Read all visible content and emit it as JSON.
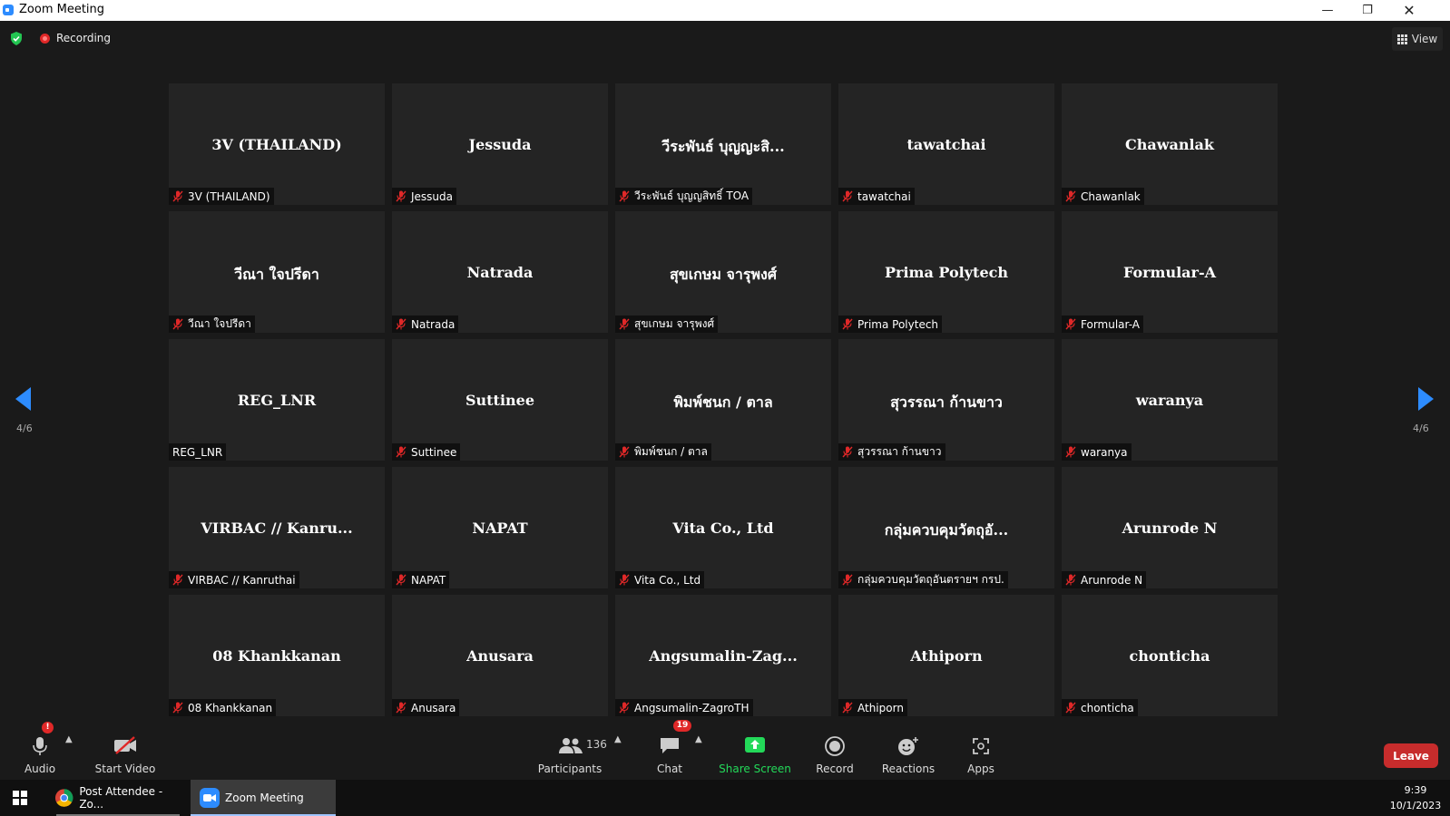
{
  "window": {
    "title": "Zoom Meeting"
  },
  "topbar": {
    "recording_label": "Recording",
    "view_label": "View"
  },
  "pagination": {
    "left": "4/6",
    "right": "4/6"
  },
  "participants": [
    {
      "display": "3V (THAILAND)",
      "name": "3V (THAILAND)",
      "muted": true
    },
    {
      "display": "Jessuda",
      "name": "Jessuda",
      "muted": true
    },
    {
      "display": "วีระพันธ์ บุญญะสิ...",
      "name": "วีระพันธ์ บุญญสิทธิ์ TOA",
      "muted": true
    },
    {
      "display": "tawatchai",
      "name": "tawatchai",
      "muted": true
    },
    {
      "display": "Chawanlak",
      "name": "Chawanlak",
      "muted": true
    },
    {
      "display": "วีณา ใจปรีดา",
      "name": "วีณา ใจปรีดา",
      "muted": true
    },
    {
      "display": "Natrada",
      "name": "Natrada",
      "muted": true
    },
    {
      "display": "สุขเกษม จารุพงศ์",
      "name": "สุขเกษม จารุพงศ์",
      "muted": true
    },
    {
      "display": "Prima Polytech",
      "name": "Prima Polytech",
      "muted": true
    },
    {
      "display": "Formular-A",
      "name": "Formular-A",
      "muted": true
    },
    {
      "display": "REG_LNR",
      "name": "REG_LNR",
      "muted": false
    },
    {
      "display": "Suttinee",
      "name": "Suttinee",
      "muted": true
    },
    {
      "display": "พิมพ์ชนก / ตาล",
      "name": "พิมพ์ชนก / ตาล",
      "muted": true
    },
    {
      "display": "สุวรรณา ก้านขาว",
      "name": "สุวรรณา ก้านขาว",
      "muted": true
    },
    {
      "display": "waranya",
      "name": "waranya",
      "muted": true
    },
    {
      "display": "VIRBAC // Kanru...",
      "name": "VIRBAC // Kanruthai",
      "muted": true
    },
    {
      "display": "NAPAT",
      "name": "NAPAT",
      "muted": true
    },
    {
      "display": "Vita Co., Ltd",
      "name": "Vita Co., Ltd",
      "muted": true
    },
    {
      "display": "กลุ่มควบคุมวัตถุอั...",
      "name": "กลุ่มควบคุมวัตถุอันตรายฯ กรป.",
      "muted": true
    },
    {
      "display": "Arunrode N",
      "name": "Arunrode N",
      "muted": true
    },
    {
      "display": "08 Khankkanan",
      "name": "08 Khankkanan",
      "muted": true
    },
    {
      "display": "Anusara",
      "name": "Anusara",
      "muted": true
    },
    {
      "display": "Angsumalin-Zag...",
      "name": "Angsumalin-ZagroTH",
      "muted": true
    },
    {
      "display": "Athiporn",
      "name": "Athiporn",
      "muted": true
    },
    {
      "display": "chonticha",
      "name": "chonticha",
      "muted": true
    }
  ],
  "toolbar": {
    "audio": "Audio",
    "audio_alert": "!",
    "start_video": "Start Video",
    "participants": "Participants",
    "participants_count": "136",
    "chat": "Chat",
    "chat_badge": "19",
    "share_screen": "Share Screen",
    "record": "Record",
    "reactions": "Reactions",
    "apps": "Apps",
    "leave": "Leave",
    "share_color": "#23d959",
    "leave_color": "#c72c2c"
  },
  "taskbar": {
    "items": [
      {
        "label": "Post Attendee - Zo...",
        "icon": "chrome-icon"
      },
      {
        "label": "Zoom Meeting",
        "icon": "zoom-icon"
      }
    ],
    "time": "9:39",
    "date": "10/1/2023"
  }
}
